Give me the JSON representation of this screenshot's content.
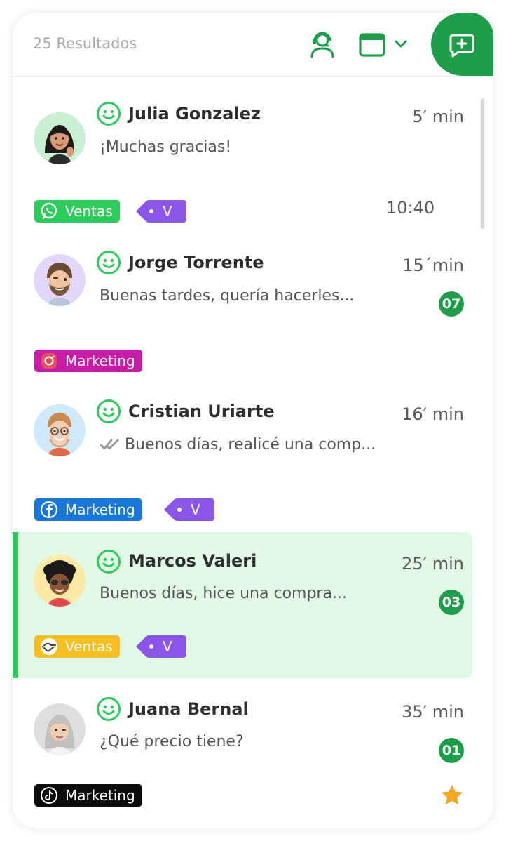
{
  "header": {
    "results_label": "25 Resultados",
    "accent_color": "#1e9e49",
    "icons": [
      "agent-headset-icon",
      "window-icon",
      "chevron-down-icon",
      "new-chat-icon"
    ]
  },
  "conversations": [
    {
      "name": "Julia Gonzalez",
      "time": "5′ min",
      "preview": "¡Muchas gracias!",
      "channel": {
        "icon": "whatsapp-icon",
        "label": "Ventas"
      },
      "label": "V",
      "scheduled": "10:40"
    },
    {
      "name": "Jorge Torrente",
      "time": "15´min",
      "preview": "Buenas tardes, quería hacerles...",
      "unread": "07",
      "channel": {
        "icon": "instagram-icon",
        "label": "Marketing"
      }
    },
    {
      "name": "Cristian Uriarte",
      "time": "16′ min",
      "preview": "Buenos días, realicé una comp...",
      "read_receipt": "double-check-icon",
      "channel": {
        "icon": "facebook-icon",
        "label": "Marketing"
      },
      "label": "V"
    },
    {
      "name": "Marcos Valeri",
      "time": "25′ min",
      "preview": "Buenos días, hice una compra...",
      "unread": "03",
      "selected": true,
      "channel": {
        "icon": "handshake-icon",
        "label": "Ventas"
      },
      "label": "V"
    },
    {
      "name": "Juana Bernal",
      "time": "35′ min",
      "preview": "¿Qué precio tiene?",
      "unread": "01",
      "channel": {
        "icon": "tiktok-icon",
        "label": "Marketing"
      },
      "starred": true
    }
  ],
  "colors": {
    "whatsapp": "#2ecc5c",
    "instagram": "#c81ba6",
    "facebook": "#1877d9",
    "gold": "#f6be21",
    "tiktok": "#0c0c0c",
    "label_purple": "#8b55e8",
    "selected_bg": "#e2f8e7",
    "star": "#f5a623"
  }
}
